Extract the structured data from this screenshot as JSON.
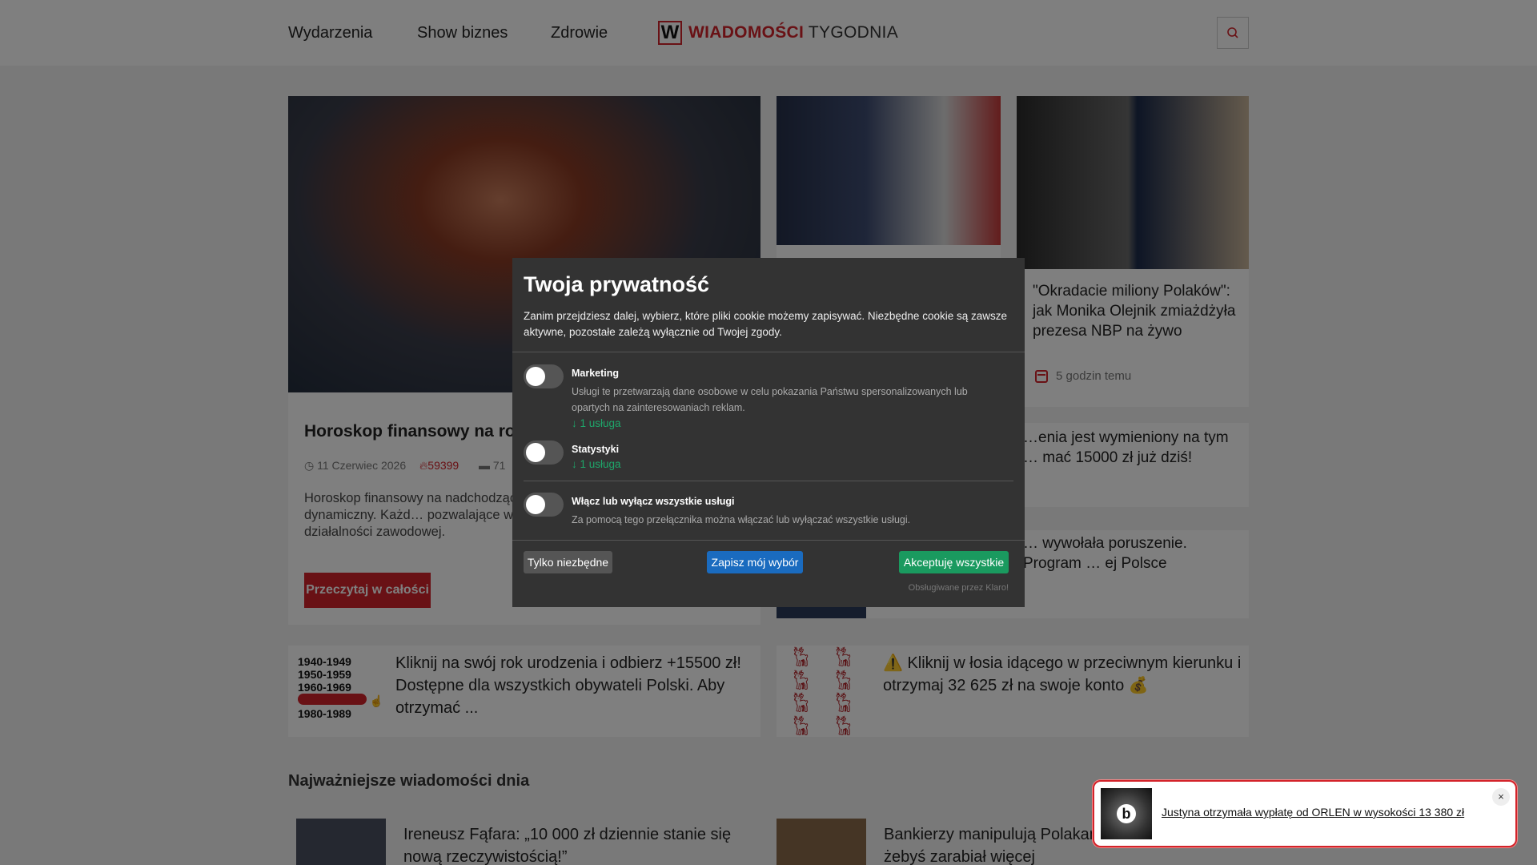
{
  "header": {
    "nav": [
      "Wydarzenia",
      "Show biznes",
      "Zdrowie"
    ],
    "logo_letter": "W",
    "logo_red": "WIADOMOŚCI",
    "logo_dark": "TYGODNIA",
    "search_icon": "search-icon"
  },
  "hero": {
    "title": "Horoskop finansowy na rok",
    "date": "11 Czerwiec 2026",
    "views": "59399",
    "comments": "71",
    "description": "Horoskop finansowy na nadchodzący … będzie nasycony i dynamiczny. Każd… pozwalające wzmocnić swoją sytuac… działalności zawodowej.",
    "read_more": "Przeczytaj w całości"
  },
  "side_articles": [
    {
      "title": "\"Okradacie miliony Polaków\": jak Monika Olejnik zmiażdżyła prezesa NBP na żywo",
      "meta": "5 godzin temu"
    },
    {
      "title": "…enia jest wymieniony na tym … mać 15000 zł już dziś!"
    },
    {
      "title": "… wywołała poruszenie. Program … ej Polsce"
    }
  ],
  "promos": [
    {
      "text": "Kliknij na swój rok urodzenia i odbierz +15500 zł! Dostępne dla wszystkich obywateli Polski. Aby otrzymać ...",
      "years": [
        "1940-1949",
        "1950-1959",
        "1960-1969",
        "1980-1989"
      ]
    },
    {
      "text": "⚠️ Kliknij w łosia idącego w przeciwnym kierunku i otrzymaj 32 625 zł na swoje konto 💰"
    }
  ],
  "section": {
    "title": "Najważniejsze wiadomości dnia",
    "items": [
      "Ireneusz Fąfara: „10 000 zł dziennie stanie się nową rzeczywistością!”",
      "Bankierzy manipulują Polakami … nie chcą, żebyś zarabiał więcej"
    ]
  },
  "cookie_modal": {
    "title": "Twoja prywatność",
    "description": "Zanim przejdziesz dalej, wybierz, które pliki cookie możemy zapisywać. Niezbędne cookie są zawsze aktywne, pozostałe zależą wyłącznie od Twojej zgody.",
    "services": [
      {
        "name": "Marketing",
        "description": "Usługi te przetwarzają dane osobowe w celu pokazania Państwu spersonalizowanych lub opartych na zainteresowaniach reklam.",
        "link": "↓ 1 usługa"
      },
      {
        "name": "Statystyki",
        "link": "↓ 1 usługa"
      }
    ],
    "toggle_all": {
      "name": "Włącz lub wyłącz wszystkie usługi",
      "description": "Za pomocą tego przełącznika można włączać lub wyłączać wszystkie usługi."
    },
    "buttons": {
      "necessary": "Tylko niezbędne",
      "save": "Zapisz mój wybór",
      "accept_all": "Akceptuję wszystkie"
    },
    "powered_by": "Obsługiwane przez Klaro!"
  },
  "notification": {
    "text": "Justyna otrzymała wypłatę od ORLEN w wysokości 13 380 zł",
    "close": "×",
    "logo_letter": "b"
  },
  "colors": {
    "brand_red": "#d3232a",
    "modal_bg": "#333333",
    "accept_green": "#1a9a5f",
    "save_blue": "#1a6bbf",
    "link_green": "#1ea66a"
  }
}
